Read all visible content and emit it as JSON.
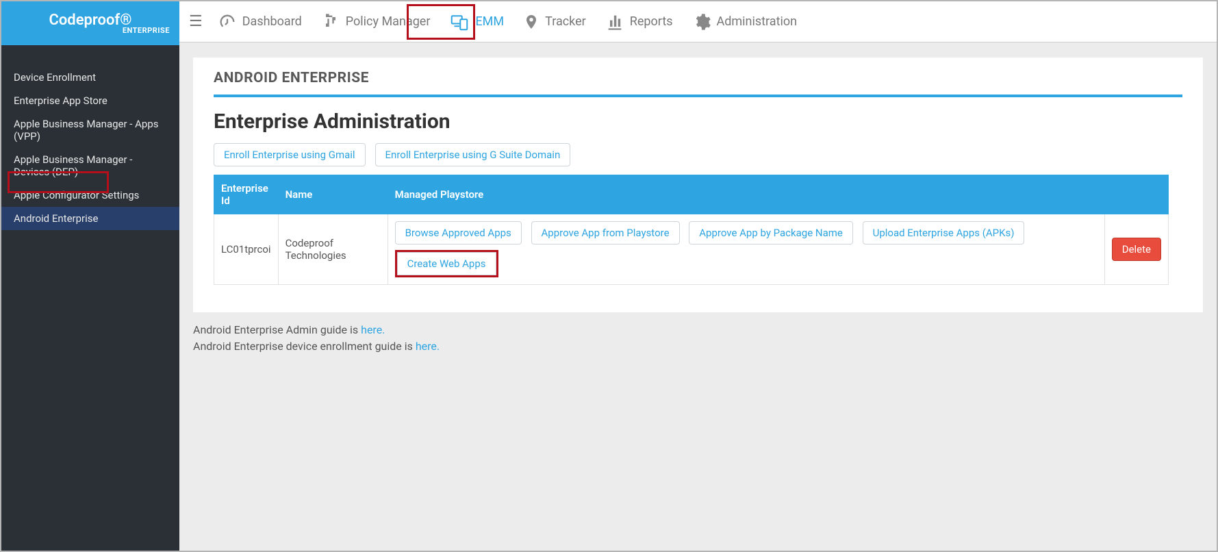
{
  "brand": {
    "title": "Codeproof®",
    "subtitle": "ENTERPRISE"
  },
  "sidebar": {
    "items": [
      {
        "label": "Device Enrollment"
      },
      {
        "label": "Enterprise App Store"
      },
      {
        "label": "Apple Business Manager - Apps (VPP)"
      },
      {
        "label": "Apple Business Manager - Devices (DEP)"
      },
      {
        "label": "Apple Configurator Settings"
      },
      {
        "label": "Android Enterprise"
      }
    ]
  },
  "topnav": {
    "items": [
      {
        "label": "Dashboard"
      },
      {
        "label": "Policy Manager"
      },
      {
        "label": "EMM"
      },
      {
        "label": "Tracker"
      },
      {
        "label": "Reports"
      },
      {
        "label": "Administration"
      }
    ]
  },
  "page": {
    "title": "ANDROID ENTERPRISE",
    "subtitle": "Enterprise Administration",
    "enroll_gmail": "Enroll Enterprise using Gmail",
    "enroll_gsuite": "Enroll Enterprise using G Suite Domain"
  },
  "table": {
    "headers": {
      "id": "Enterprise Id",
      "name": "Name",
      "playstore": "Managed Playstore",
      "actions": ""
    },
    "row": {
      "id": "LC01tprcoi",
      "name": "Codeproof Technologies",
      "buttons": {
        "browse": "Browse Approved Apps",
        "approve_playstore": "Approve App from Playstore",
        "approve_package": "Approve App by Package Name",
        "upload": "Upload Enterprise Apps (APKs)",
        "create_web": "Create Web Apps"
      },
      "delete": "Delete"
    }
  },
  "footnotes": {
    "line1_pre": "Android Enterprise Admin guide is ",
    "line1_link": "here.",
    "line2_pre": "Android Enterprise device enrollment guide is ",
    "line2_link": "here."
  }
}
